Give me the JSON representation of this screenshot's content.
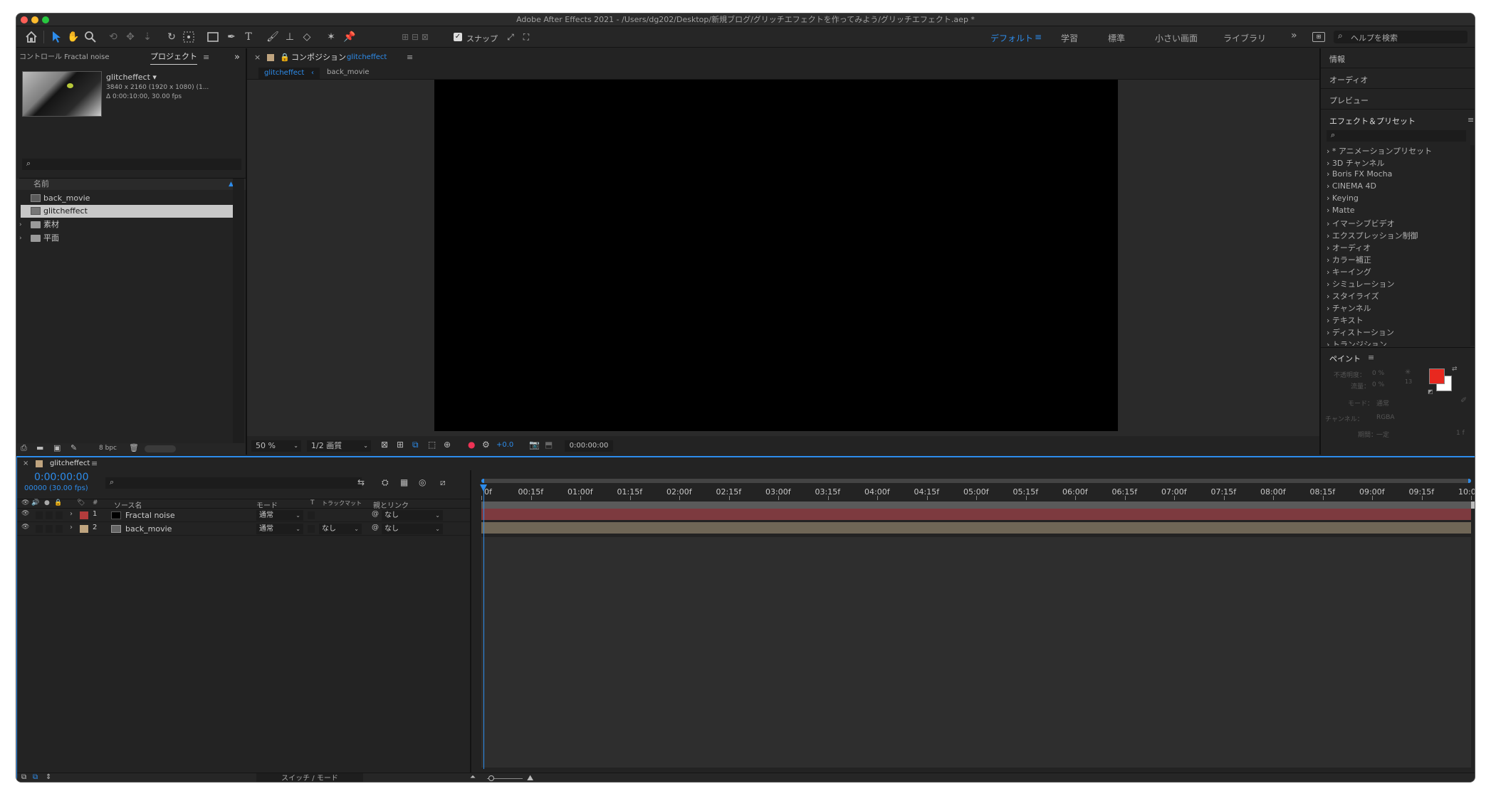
{
  "window": {
    "title": "Adobe After Effects 2021 - /Users/dg202/Desktop/新規ブログ/グリッチエフェクトを作ってみよう/グリッチエフェクト.aep *"
  },
  "toolbar": {
    "snap_label": "スナップ",
    "snap_checked": true,
    "workspaces": [
      "デフォルト",
      "学習",
      "標準",
      "小さい画面",
      "ライブラリ"
    ],
    "help_search_placeholder": "ヘルプを検索",
    "more": "»"
  },
  "project_panel": {
    "tab_control": "コントロール Fractal noise",
    "tab_project": "プロジェクト",
    "selected_name": "glitcheffect ▾",
    "selected_info1": "3840 x 2160  (1920 x 1080) (1...",
    "selected_info2": "Δ 0:00:10:00, 30.00 fps",
    "col_name": "名前",
    "items": [
      {
        "name": "back_movie",
        "type": "comp",
        "selected": false
      },
      {
        "name": "glitcheffect",
        "type": "comp",
        "selected": true
      },
      {
        "name": "素材",
        "type": "folder",
        "selected": false
      },
      {
        "name": "平面",
        "type": "folder",
        "selected": false
      }
    ],
    "bpc": "8 bpc"
  },
  "comp_panel": {
    "title_prefix": "コンポジション",
    "title_name": "glitcheffect",
    "tabs": [
      "glitcheffect",
      "back_movie"
    ],
    "zoom": "50 %",
    "resolution": "1/2 画質",
    "exposure": "+0.0",
    "timecode": "0:00:00:00"
  },
  "right_panel": {
    "sections": [
      "情報",
      "オーディオ",
      "プレビュー"
    ],
    "effects_title": "エフェクト＆プリセット",
    "effects": [
      "* アニメーションプリセット",
      "3D チャンネル",
      "Boris FX Mocha",
      "CINEMA 4D",
      "Keying",
      "Matte",
      "イマーシブビデオ",
      "エクスプレッション制御",
      "オーディオ",
      "カラー補正",
      "キーイング",
      "シミュレーション",
      "スタイライズ",
      "チャンネル",
      "テキスト",
      "ディストーション",
      "トランジション"
    ],
    "paint_title": "ペイント",
    "paint_opacity_label": "不透明度：",
    "paint_opacity_value": "0 %",
    "paint_flow_label": "流量：",
    "paint_flow_value": "0 %",
    "paint_mode_label": "モード：",
    "paint_mode_value": "通常",
    "paint_channel_label": "チャンネル：",
    "paint_channel_value": "RGBA",
    "paint_duration_label": "期間：",
    "paint_duration_value": "一定",
    "paint_brush_size": "13",
    "paint_frames": "1 f",
    "fg_color": "#e8281f",
    "bg_color": "#ffffff"
  },
  "timeline": {
    "tab": "glitcheffect",
    "timecode": "0:00:00:00",
    "frames": "00000 (30.00 fps)",
    "columns": {
      "source": "ソース名",
      "mode": "モード",
      "t": "T",
      "trkmat": "トラックマット",
      "parent": "親とリンク",
      "hash": "#"
    },
    "layers": [
      {
        "num": "1",
        "name": "Fractal noise",
        "mode": "通常",
        "trkmat": "",
        "parent": "なし",
        "label_color": "#b33c3c",
        "bar_color": "#7d3a3f"
      },
      {
        "num": "2",
        "name": "back_movie",
        "mode": "通常",
        "trkmat": "なし",
        "parent": "なし",
        "label_color": "#bfa47f",
        "bar_color": "#6f6656"
      }
    ],
    "ruler": [
      "0f",
      "00:15f",
      "01:00f",
      "01:15f",
      "02:00f",
      "02:15f",
      "03:00f",
      "03:15f",
      "04:00f",
      "04:15f",
      "05:00f",
      "05:15f",
      "06:00f",
      "06:15f",
      "07:00f",
      "07:15f",
      "08:00f",
      "08:15f",
      "09:00f",
      "09:15f",
      "10:0"
    ],
    "footer": "スイッチ / モード"
  }
}
